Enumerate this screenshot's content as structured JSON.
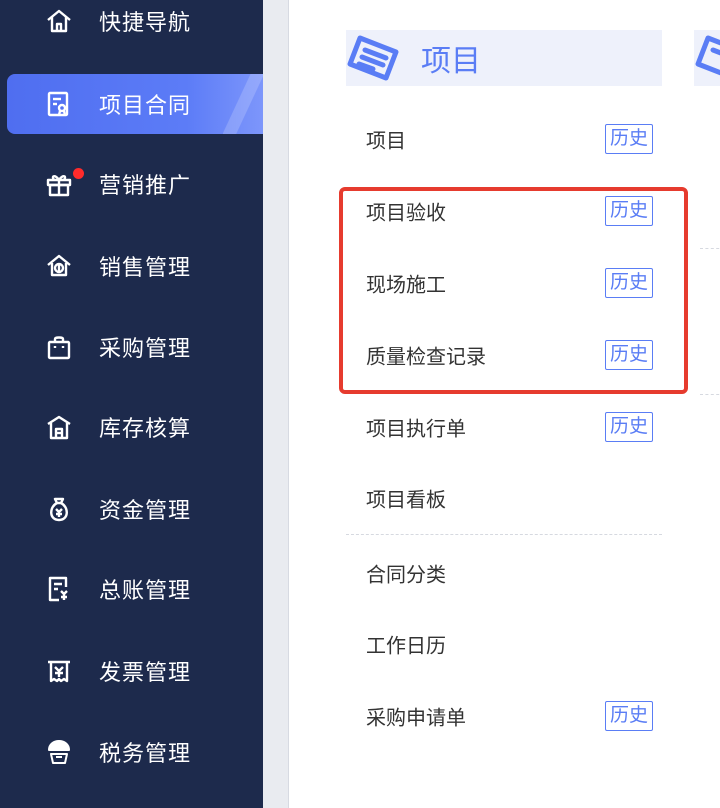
{
  "sidebar": {
    "items": [
      {
        "label": "快捷导航",
        "icon": "home-icon"
      },
      {
        "label": "项目合同",
        "icon": "contract-icon",
        "active": true
      },
      {
        "label": "营销推广",
        "icon": "gift-icon",
        "badge": true
      },
      {
        "label": "销售管理",
        "icon": "sales-icon"
      },
      {
        "label": "采购管理",
        "icon": "bag-icon"
      },
      {
        "label": "库存核算",
        "icon": "warehouse-icon"
      },
      {
        "label": "资金管理",
        "icon": "money-bag-icon"
      },
      {
        "label": "总账管理",
        "icon": "ledger-icon"
      },
      {
        "label": "发票管理",
        "icon": "invoice-icon"
      },
      {
        "label": "税务管理",
        "icon": "tax-icon"
      }
    ]
  },
  "main": {
    "section": {
      "title": "项目",
      "icon": "document-icon"
    },
    "rows": [
      {
        "label": "项目",
        "history": "历史"
      },
      {
        "label": "项目验收",
        "history": "历史"
      },
      {
        "label": "现场施工",
        "history": "历史"
      },
      {
        "label": "质量检查记录",
        "history": "历史"
      },
      {
        "label": "项目执行单",
        "history": "历史"
      },
      {
        "label": "项目看板"
      },
      {
        "label": "合同分类"
      },
      {
        "label": "工作日历"
      },
      {
        "label": "采购申请单",
        "history": "历史"
      }
    ]
  },
  "colors": {
    "sidebar_bg": "#1d2a4c",
    "active_bg": "#5470f2",
    "accent": "#5a7df5",
    "highlight": "#e63b2e",
    "badge": "#ff2b2b"
  }
}
